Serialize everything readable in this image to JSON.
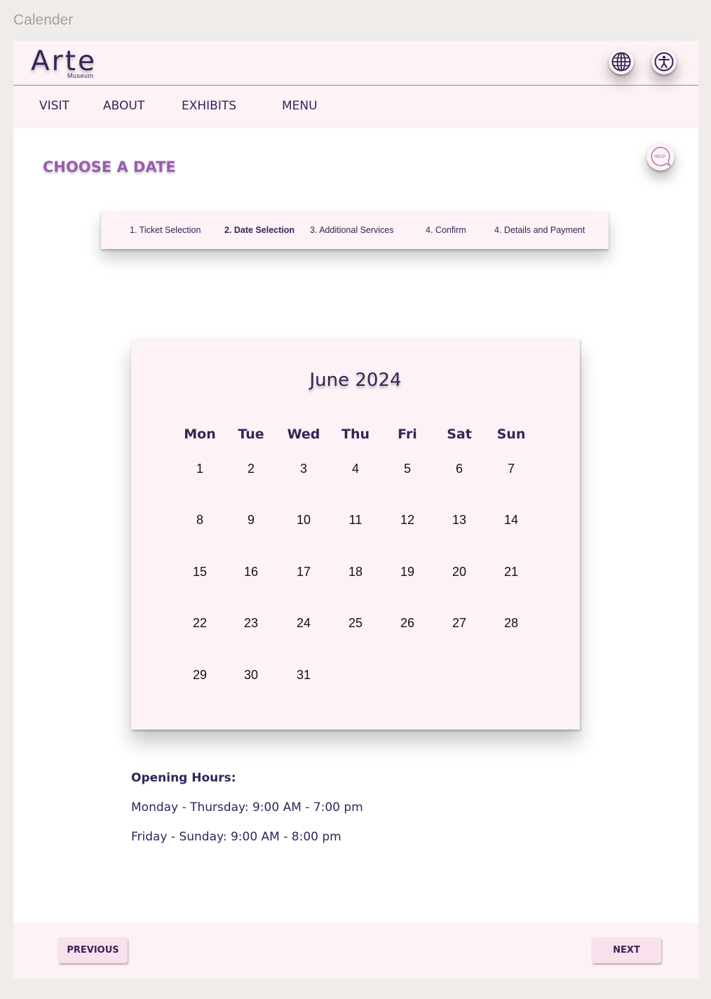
{
  "canvas": {
    "title": "Calender"
  },
  "header": {
    "logo": {
      "name": "Arte",
      "subtitle": "Museum"
    },
    "icons": {
      "language": "globe-icon",
      "accessibility": "accessibility-icon"
    }
  },
  "nav": {
    "items": [
      "VISIT",
      "ABOUT",
      "EXHIBITS",
      "MENU"
    ]
  },
  "help": {
    "label": "HELP"
  },
  "page": {
    "title": "CHOOSE A DATE"
  },
  "stepper": {
    "steps": [
      {
        "label": "1. Ticket Selection",
        "active": false
      },
      {
        "label": "2. Date Selection",
        "active": true
      },
      {
        "label": "3. Additional Services",
        "active": false
      },
      {
        "label": "4. Confirm",
        "active": false
      },
      {
        "label": "4. Details and Payment",
        "active": false
      }
    ]
  },
  "calendar": {
    "month": "June 2024",
    "weekdays": [
      "Mon",
      "Tue",
      "Wed",
      "Thu",
      "Fri",
      "Sat",
      "Sun"
    ],
    "weeks": [
      [
        "1",
        "2",
        "3",
        "4",
        "5",
        "6",
        "7"
      ],
      [
        "8",
        "9",
        "10",
        "11",
        "12",
        "13",
        "14"
      ],
      [
        "15",
        "16",
        "17",
        "18",
        "19",
        "20",
        "21"
      ],
      [
        "22",
        "23",
        "24",
        "25",
        "26",
        "27",
        "28"
      ],
      [
        "29",
        "30",
        "31"
      ]
    ]
  },
  "hours": {
    "title": "Opening Hours:",
    "lines": [
      "Monday - Thursday: 9:00 AM - 7:00 pm",
      "Friday - Sunday: 9:00 AM - 8:00 pm"
    ]
  },
  "footer": {
    "previous": "PREVIOUS",
    "next": "NEXT"
  },
  "colors": {
    "primary": "#342458",
    "accent": "#9a5cb0",
    "panel": "#fdf2f5",
    "button": "#f8e1ec"
  }
}
